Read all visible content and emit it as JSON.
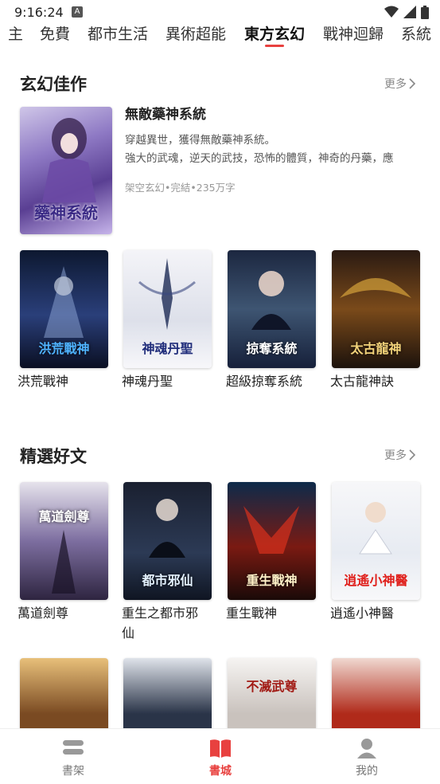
{
  "status_bar": {
    "time": "9:16:24",
    "notif_icon": "A"
  },
  "tabs": [
    {
      "label": "主"
    },
    {
      "label": "免費"
    },
    {
      "label": "都市生活"
    },
    {
      "label": "異術超能"
    },
    {
      "label": "東方玄幻"
    },
    {
      "label": "戰神迴歸"
    },
    {
      "label": "系統"
    }
  ],
  "active_tab": "東方玄幻",
  "section1": {
    "title": "玄幻佳作",
    "more": "更多",
    "featured": {
      "title": "無敵藥神系統",
      "desc_line1": "穿越異世，獲得無敵藥神系統。",
      "desc_line2": "強大的武魂，逆天的武技，恐怖的體質，神奇的丹藥，應",
      "meta": "架空玄幻•完結•235万字",
      "cover_text": "藥神系統"
    },
    "books": [
      {
        "name": "洪荒戰神",
        "cover_text": "洪荒戰神"
      },
      {
        "name": "神魂丹聖",
        "cover_text": "神魂丹聖"
      },
      {
        "name": "超級掠奪系統",
        "cover_text": "掠奪系統"
      },
      {
        "name": "太古龍神訣",
        "cover_text": "太古龍神"
      }
    ]
  },
  "section2": {
    "title": "精選好文",
    "more": "更多",
    "books": [
      {
        "name": "萬道劍尊",
        "cover_text": "萬道劍尊"
      },
      {
        "name_line1": "重生之都市邪",
        "name_line2": "仙",
        "cover_text": "都市邪仙"
      },
      {
        "name": "重生戰神",
        "cover_text": "重生戰神"
      },
      {
        "name": "逍遙小神醫",
        "cover_text": "逍遙小神醫"
      }
    ],
    "partial_covers": [
      {
        "cover_text": ""
      },
      {
        "cover_text": ""
      },
      {
        "cover_text": "不滅武尊"
      },
      {
        "cover_text": ""
      }
    ]
  },
  "bottom_nav": [
    {
      "label": "書架",
      "icon": "bookshelf-icon"
    },
    {
      "label": "書城",
      "icon": "open-book-icon"
    },
    {
      "label": "我的",
      "icon": "user-icon"
    }
  ],
  "colors": {
    "accent": "#e8413f",
    "text": "#222222",
    "muted": "#888888"
  }
}
